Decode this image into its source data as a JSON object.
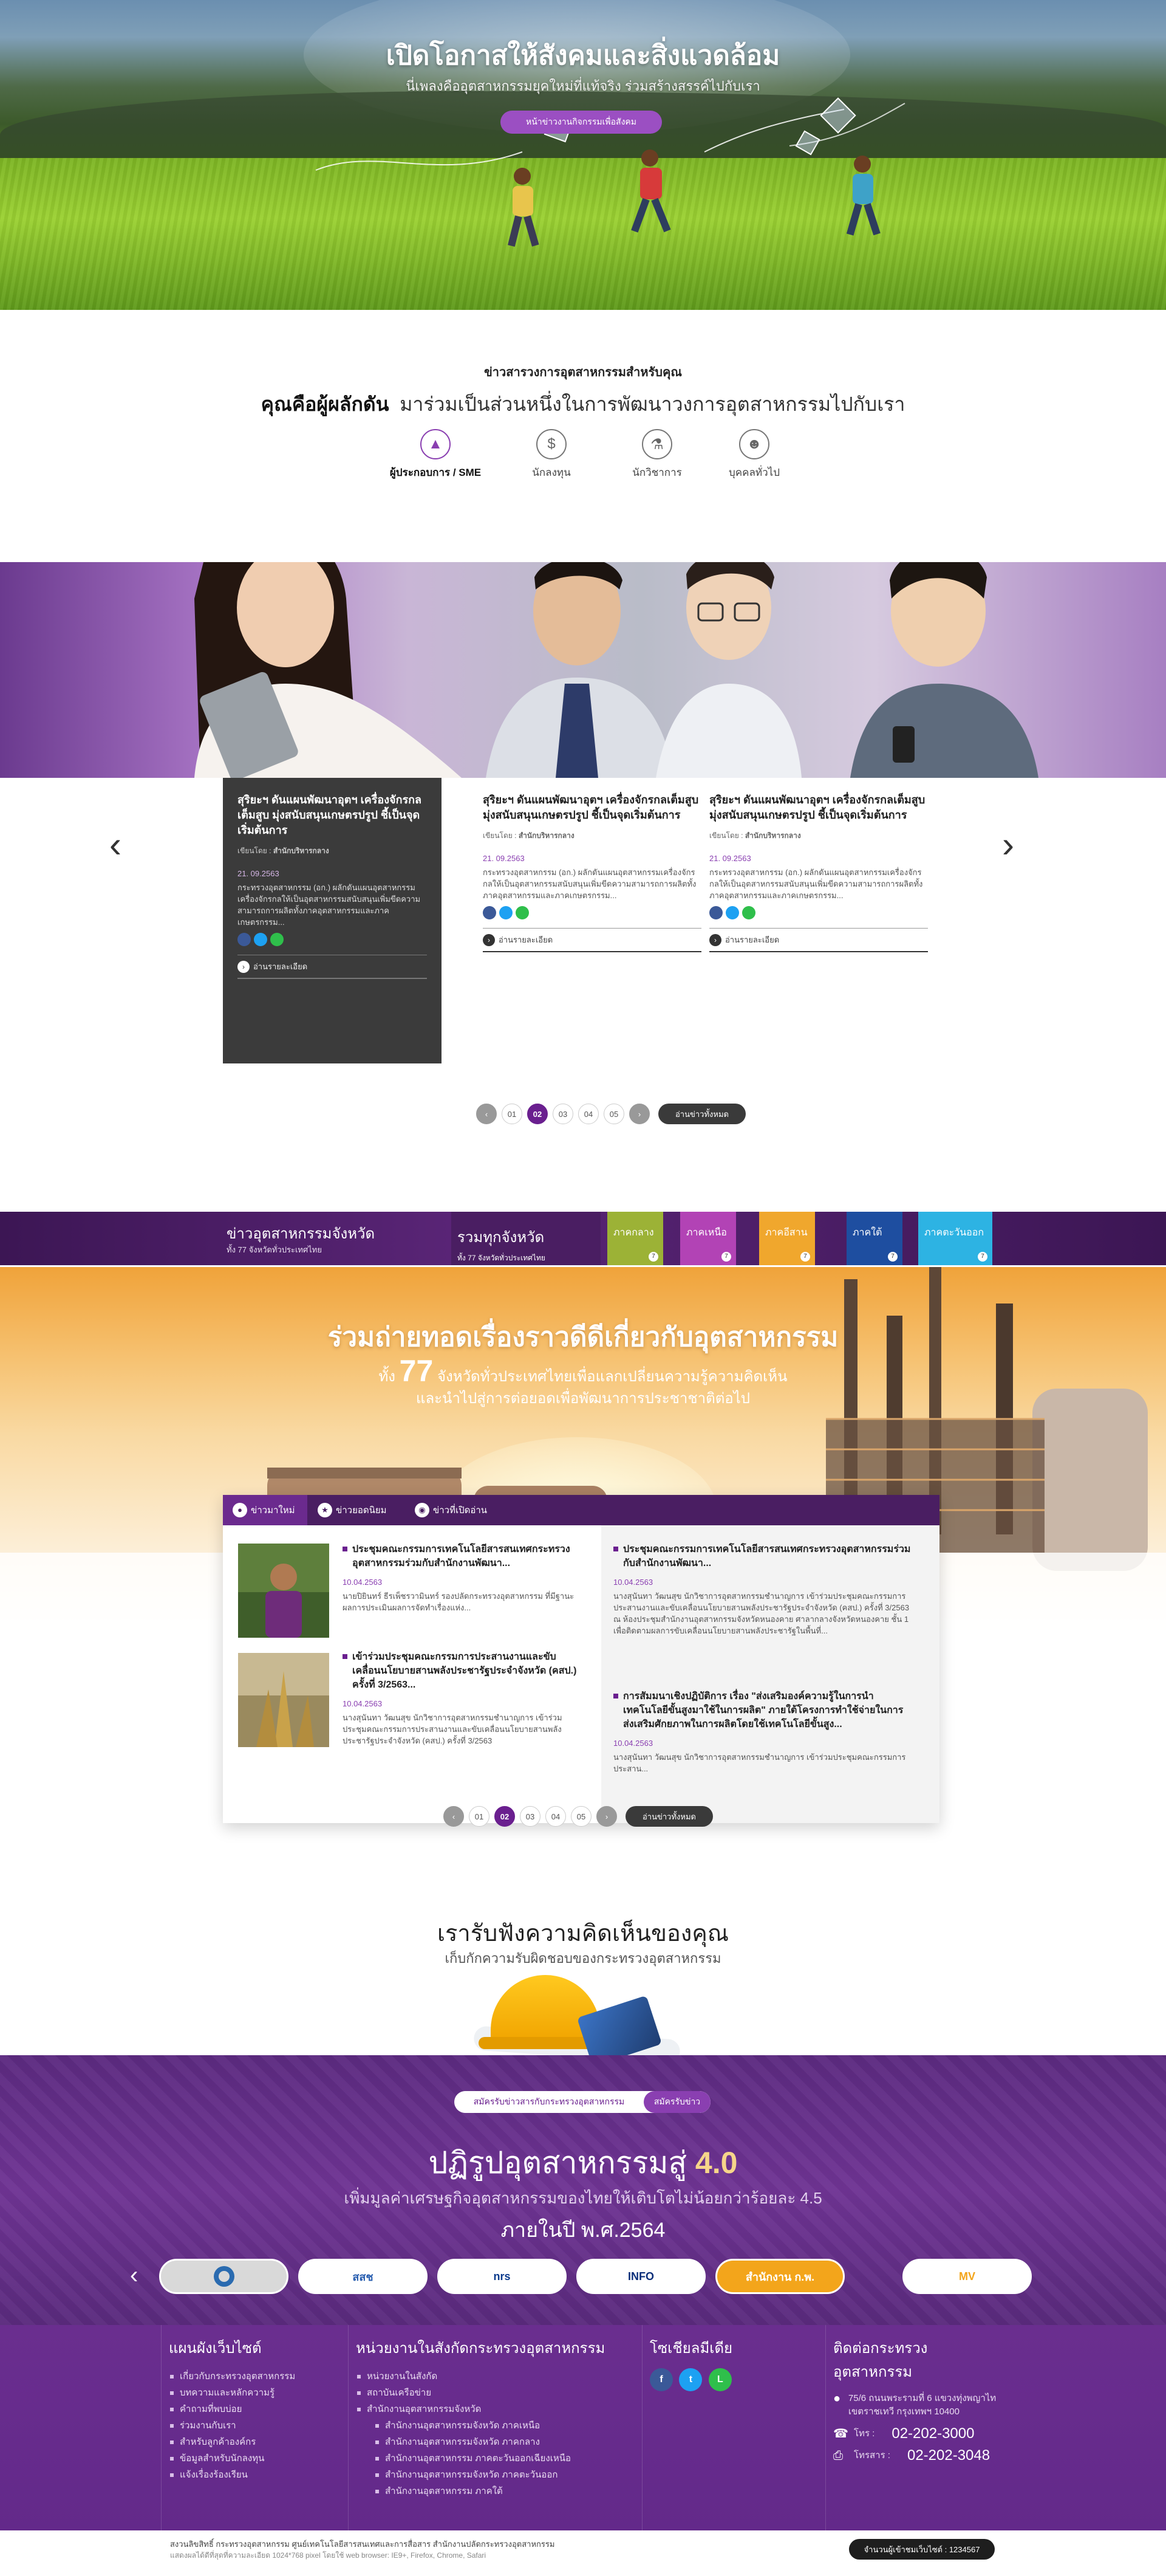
{
  "hero": {
    "title": "เปิดโอกาสให้สังคมและสิ่งแวดล้อม",
    "subtitle": "นี่เพลงคืออุตสาหกรรมยุคใหม่ที่แท้จริง ร่วมสร้างสรรค์ไปกับเรา",
    "button": "หน้าข่าวงานกิจกรรมเพื่อสังคม"
  },
  "intro": {
    "subheading": "ข่าวสารวงการอุตสาหกรรมสำหรับคุณ",
    "heading_bold": "คุณคือผู้ผลักดัน",
    "heading_rest": "มาร่วมเป็นส่วนหนึ่งในการพัฒนาวงการอุตสาหกรรมไปกับเรา",
    "audiences": [
      {
        "label": "ผู้ประกอบการ / SME",
        "icon": "rocket-icon"
      },
      {
        "label": "นักลงทุน",
        "icon": "coin-icon"
      },
      {
        "label": "นักวิชาการ",
        "icon": "microscope-icon"
      },
      {
        "label": "บุคคลทั่วไป",
        "icon": "people-icon"
      }
    ]
  },
  "news": {
    "cards": [
      {
        "title": "สุริยะฯ ดันแผนพัฒนาอุตฯ เครื่องจักรกลเต็มสูบ มุ่งสนับสนุนเกษตรปรูป ชี้เป็นจุดเริ่มต้นการ",
        "by_label": "เขียนโดย :",
        "by": "สำนักบริหารกลาง",
        "date": "21. 09.2563",
        "body": "กระทรวงอุตสาหกรรม (อก.) ผลักดันแผนอุตสาหกรรมเครื่องจักรกลให้เป็นอุตสาหกรรมสนับสนุนเพิ่มขีดความสามารถการผลิตทั้งภาคอุตสาหกรรมและภาคเกษตรกรรม...",
        "more": "อ่านรายละเอียด"
      },
      {
        "title": "สุริยะฯ ดันแผนพัฒนาอุตฯ เครื่องจักรกลเต็มสูบ มุ่งสนับสนุนเกษตรปรูป ชี้เป็นจุดเริ่มต้นการ",
        "by_label": "เขียนโดย :",
        "by": "สำนักบริหารกลาง",
        "date": "21. 09.2563",
        "body": "กระทรวงอุตสาหกรรม (อก.) ผลักดันแผนอุตสาหกรรมเครื่องจักรกลให้เป็นอุตสาหกรรมสนับสนุนเพิ่มขีดความสามารถการผลิตทั้งภาคอุตสาหกรรมและภาคเกษตรกรรม...",
        "more": "อ่านรายละเอียด"
      },
      {
        "title": "สุริยะฯ ดันแผนพัฒนาอุตฯ เครื่องจักรกลเต็มสูบ มุ่งสนับสนุนเกษตรปรูป ชี้เป็นจุดเริ่มต้นการ",
        "by_label": "เขียนโดย :",
        "by": "สำนักบริหารกลาง",
        "date": "21. 09.2563",
        "body": "กระทรวงอุตสาหกรรม (อก.) ผลักดันแผนอุตสาหกรรมเครื่องจักรกลให้เป็นอุตสาหกรรมสนับสนุนเพิ่มขีดความสามารถการผลิตทั้งภาคอุตสาหกรรมและภาคเกษตรกรรม...",
        "more": "อ่านรายละเอียด"
      }
    ],
    "pages": [
      "01",
      "02",
      "03",
      "04",
      "05"
    ],
    "current_page": "02",
    "all_label": "อ่านข่าวทั้งหมด"
  },
  "region": {
    "bar_title": "ข่าวอุตสาหกรรมจังหวัด",
    "bar_sub": "ทั้ง 77 จังหวัดทั่วประเทศไทย",
    "tabs": [
      {
        "label": "รวมทุกจังหวัด",
        "sub": "ทั้ง 77 จังหวัดทั่วประเทศไทย",
        "color": "#4a1e62"
      },
      {
        "label": "ภาคกลาง",
        "n": "7",
        "color": "#9cb236"
      },
      {
        "label": "ภาคเหนือ",
        "n": "7",
        "color": "#b243b5"
      },
      {
        "label": "ภาคอีสาน",
        "n": "7",
        "color": "#f0a72d"
      },
      {
        "label": "ภาคใต้",
        "n": "7",
        "color": "#1e4ea0"
      },
      {
        "label": "ภาคตะวันออก",
        "n": "7",
        "color": "#2db3e3"
      }
    ],
    "hero_title": "ร่วมถ่ายทอดเรื่องราวดีดีเกี่ยวกับอุตสาหกรรม",
    "hero_l2_pre": "ทั้ง",
    "hero_l2_num": "77",
    "hero_l2_post": "จังหวัดทั่วประเทศไทยเพื่อแลกเปลี่ยนความรู้ความคิดเห็น",
    "hero_l3": "และนำไปสู่การต่อยอดเพื่อพัฒนาการประชาชาติต่อไป",
    "box_tabs": [
      {
        "label": "ข่าวมาใหม่",
        "icon": "pin-icon"
      },
      {
        "label": "ข่าวยอดนิยม",
        "icon": "star-icon"
      },
      {
        "label": "ข่าวที่เปิดอ่าน",
        "icon": "eye-icon"
      }
    ],
    "items": [
      {
        "title": "ประชุมคณะกรรมการเทคโนโลยีสารสนเทศกระทรวงอุตสาหกรรมร่วมกับสำนักงานพัฒนา...",
        "date": "10.04.2563",
        "body": "นายปิยินทร์ ธีรเพ็ชรวามินทร์ รองปลัดกระทรวงอุตสาหกรรม ที่มีฐานะผลการประเมินผลการจัดทำเรื่องแห่ง..."
      },
      {
        "title": "เข้าร่วมประชุมคณะกรรมการประสานงานและขับเคลื่อนนโยบายสานพลังประชารัฐประจำจังหวัด (คสป.) ครั้งที่ 3/2563...",
        "date": "10.04.2563",
        "body": "นางสุนันทา วัฒนสุข นักวิชาการอุตสาหกรรมชำนาญการ เข้าร่วมประชุมคณะกรรมการประสานงานและขับเคลื่อนนโยบายสานพลังประชารัฐประจำจังหวัด (คสป.) ครั้งที่ 3/2563"
      },
      {
        "title": "ประชุมคณะกรรมการเทคโนโลยีสารสนเทศกระทรวงอุตสาหกรรมร่วมกับสำนักงานพัฒนา...",
        "date": "10.04.2563",
        "body": "นางสุนันทา วัฒนสุข นักวิชาการอุตสาหกรรมชำนาญการ เข้าร่วมประชุมคณะกรรมการประสานงานและขับเคลื่อนนโยบายสานพลังประชารัฐประจำจังหวัด (คสป.) ครั้งที่ 3/2563 ณ ห้องประชุมสำนักงานอุตสาหกรรมจังหวัดหนองคาย ศาลากลางจังหวัดหนองคาย ชั้น 1 เพื่อติดตามผลการขับเคลื่อนนโยบายสานพลังประชารัฐในพื้นที่..."
      },
      {
        "title": "การสัมมนาเชิงปฏิบัติการ เรื่อง \"ส่งเสริมองค์ความรู้ในการนำเทคโนโลยีขั้นสูงมาใช้ในการผลิต\" ภายใต้โครงการทำใช้จ่ายในการส่งเสริมศักยภาพในการผลิตโดยใช้เทคโนโลยีขั้นสูง...",
        "date": "10.04.2563",
        "body": "นางสุนันทา วัฒนสุข นักวิชาการอุตสาหกรรมชำนาญการ เข้าร่วมประชุมคณะกรรมการประสาน..."
      }
    ],
    "pages": [
      "01",
      "02",
      "03",
      "04",
      "05"
    ],
    "current_page": "02",
    "all_label": "อ่านข่าวทั้งหมด"
  },
  "feedback": {
    "title": "เรารับฟังความคิดเห็นของคุณ",
    "subtitle": "เก็บกักความรับผิดชอบของกระทรวงอุตสาหกรรม"
  },
  "i40": {
    "pill_text": "สมัครรับข่าวสารกับกระทรวงอุตสาหกรรม",
    "pill_button": "สมัครรับข่าว",
    "title_pre": "ปฏิรูปอุตสาหกรรมสู่",
    "title_num": "4.0",
    "line2": "เพิ่มมูลค่าเศรษฐกิจอุตสาหกรรมของไทยให้เติบโตไม่น้อยกว่าร้อยละ 4.5",
    "line3": "ภายในปี พ.ศ.2564",
    "logos": [
      {
        "name": "logo-ministry",
        "text": "",
        "color": "#2a6bb0",
        "bg": "#d9d9d9"
      },
      {
        "name": "logo-sso",
        "text": "สสช",
        "color": "#2a5fb0",
        "bg": "#ffffff"
      },
      {
        "name": "logo-nrs",
        "text": "nrs",
        "color": "#0b3a8c",
        "bg": "#ffffff"
      },
      {
        "name": "logo-info",
        "text": "INFO",
        "color": "#0b2f7a",
        "bg": "#ffffff"
      },
      {
        "name": "logo-ocsc",
        "text": "สำนักงาน ก.พ.",
        "color": "#ffffff",
        "bg": "#f3a51b"
      },
      {
        "name": "logo-mv",
        "text": "MV",
        "color": "#f3a51b",
        "bg": "#ffffff"
      }
    ]
  },
  "footer": {
    "col1_title": "แผนผังเว็บไซต์",
    "col1_items": [
      "เกี่ยวกับกระทรวงอุตสาหกรรม",
      "บทความและหลักความรู้",
      "คำถามที่พบบ่อย",
      "ร่วมงานกับเรา",
      "สำหรับลูกค้าองค์กร",
      "ข้อมูลสำหรับนักลงทุน",
      "แจ้งเรื่องร้องเรียน"
    ],
    "col2_title": "หน่วยงานในสังกัดกระทรวงอุตสาหกรรม",
    "col2_items": [
      "หน่วยงานในสังกัด",
      "สถาบันเครือข่าย",
      "สำนักงานอุตสาหกรรมจังหวัด"
    ],
    "col2_sub": [
      "สำนักงานอุตสาหกรรมจังหวัด ภาคเหนือ",
      "สำนักงานอุตสาหกรรมจังหวัด ภาคกลาง",
      "สำนักงานอุตสาหกรรม ภาคตะวันออกเฉียงเหนือ",
      "สำนักงานอุตสาหกรรมจังหวัด ภาคตะวันออก",
      "สำนักงานอุตสาหกรรม ภาคใต้"
    ],
    "col3_title": "โซเชียลมีเดีย",
    "col4_title": "ติดต่อกระทรวงอุตสาหกรรม",
    "address": "75/6 ถนนพระรามที่ 6 แขวงทุ่งพญาไท เขตราชเทวี กรุงเทพฯ 10400",
    "tel_label": "โทร :",
    "tel": "02-202-3000",
    "fax_label": "โทรสาร :",
    "fax": "02-202-3048"
  },
  "bottom": {
    "copyright": "สงวนลิขสิทธิ์ กระทรวงอุตสาหกรรม ศูนย์เทคโนโลยีสารสนเทศและการสื่อสาร สำนักงานปลัดกระทรวงอุตสาหกรรม",
    "browser": "แสดงผลได้ดีที่สุดที่ความละเอียด 1024*768 pixel โดยใช้ web browser: IE9+, Firefox, Chrome, Safari",
    "counter": "จำนวนผู้เข้าชมเว็บไซต์ : 1234567"
  }
}
